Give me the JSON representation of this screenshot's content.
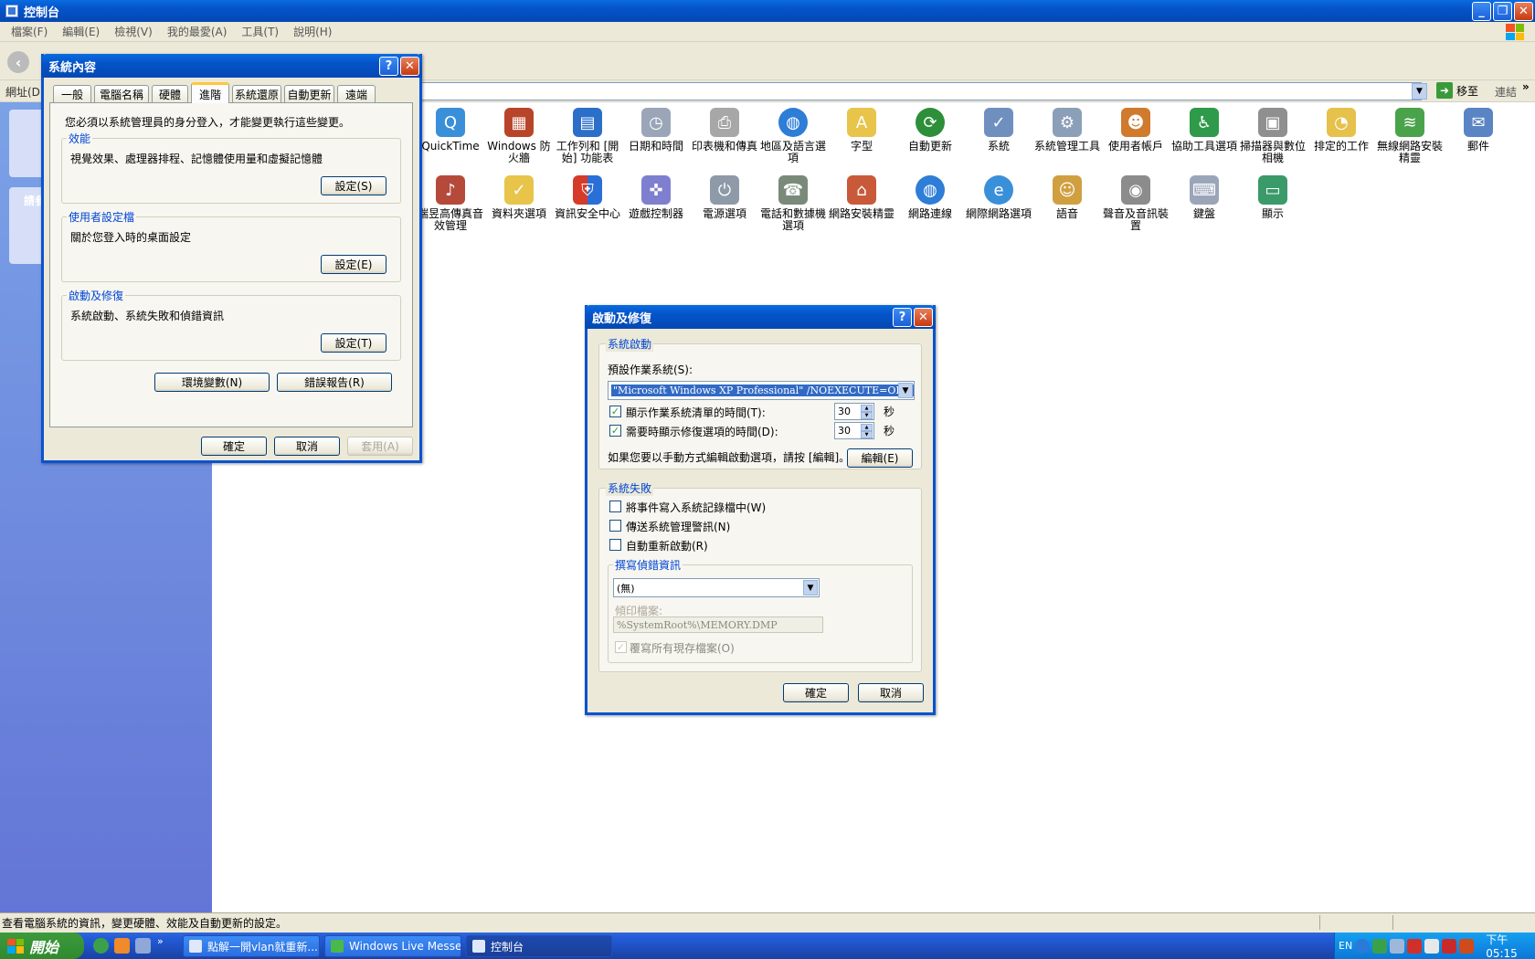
{
  "main_window": {
    "title": "控制台",
    "menu": [
      "檔案(F)",
      "編輯(E)",
      "檢視(V)",
      "我的最愛(A)",
      "工具(T)",
      "說明(H)"
    ],
    "address_label": "網址(D)",
    "go_label": "移至",
    "links_label": "連結",
    "links_more": "»"
  },
  "icons_row1": [
    "QuickTime",
    "Windows 防火牆",
    "工作列和 [開始] 功能表",
    "日期和時間",
    "印表機和傳真",
    "地區及語言選項",
    "字型",
    "自動更新",
    "系統",
    "系統管理工具",
    "使用者帳戶",
    "協助工具選項",
    "掃描器與數位相機",
    "排定的工作",
    "無線網路安裝精靈",
    "郵件"
  ],
  "icons_row2": [
    "瑞昱高傳真音效管理",
    "資料夾選項",
    "資訊安全中心",
    "遊戲控制器",
    "電源選項",
    "電話和數據機選項",
    "網路安裝精靈",
    "網路連線",
    "網際網路選項",
    "語音",
    "聲音及音訊裝置",
    "鍵盤",
    "顯示"
  ],
  "left_pane": {
    "sidebar_heading": "請參"
  },
  "sysprop": {
    "title": "系統內容",
    "tabs": [
      "一般",
      "電腦名稱",
      "硬體",
      "進階",
      "系統還原",
      "自動更新",
      "遠端"
    ],
    "admin_note": "您必須以系統管理員的身分登入，才能變更執行這些變更。",
    "perf_title": "效能",
    "perf_desc": "視覺效果、處理器排程、記憶體使用量和虛擬記憶體",
    "perf_btn": "設定(S)",
    "profile_title": "使用者設定檔",
    "profile_desc": "關於您登入時的桌面設定",
    "profile_btn": "設定(E)",
    "startup_title": "啟動及修復",
    "startup_desc": "系統啟動、系統失敗和偵錯資訊",
    "startup_btn": "設定(T)",
    "env_btn": "環境變數(N)",
    "err_btn": "錯誤報告(R)",
    "ok": "確定",
    "cancel": "取消",
    "apply": "套用(A)"
  },
  "startup": {
    "title": "啟動及修復",
    "sys_start_title": "系統啟動",
    "default_os_label": "預設作業系統(S):",
    "default_os_value": "\"Microsoft Windows XP Professional\" /NOEXECUTE=OPTIN /FA",
    "show_list_label": "顯示作業系統清單的時間(T):",
    "show_list_value": "30",
    "show_list_unit": "秒",
    "show_recovery_label": "需要時顯示修復選項的時間(D):",
    "show_recovery_value": "30",
    "show_recovery_unit": "秒",
    "edit_note": "如果您要以手動方式編輯啟動選項，請按 [編輯]。",
    "edit_btn": "編輯(E)",
    "sys_fail_title": "系統失敗",
    "write_event": "將事件寫入系統記錄檔中(W)",
    "send_alert": "傳送系統管理警訊(N)",
    "auto_restart": "自動重新啟動(R)",
    "debug_title": "撰寫偵錯資訊",
    "debug_value": "(無)",
    "dump_label": "傾印檔案:",
    "dump_value": "%SystemRoot%\\MEMORY.DMP",
    "overwrite": "覆寫所有現存檔案(O)",
    "ok": "確定",
    "cancel": "取消",
    "checks": {
      "show_list": true,
      "show_recovery": true,
      "write_event": false,
      "send_alert": false,
      "auto_restart": false,
      "overwrite": true
    }
  },
  "status_text": "查看電腦系統的資訊，變更硬體、效能及自動更新的設定。",
  "taskbar": {
    "start": "開始",
    "tasks": [
      "點解一開vlan就重新...",
      "Windows Live Messen...",
      "控制台"
    ],
    "tray_lang": "EN",
    "clock": "下午 05:15"
  },
  "colors": {
    "xp_blue": "#0553c8",
    "dialog_bg": "#ece9d8",
    "group_title": "#0046d5",
    "start_green": "#3c9a3c"
  }
}
